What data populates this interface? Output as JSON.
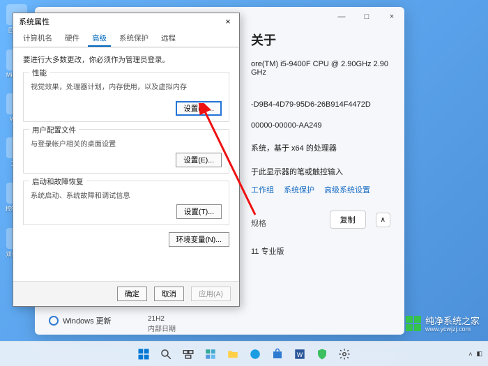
{
  "desktop": {
    "icons": [
      "回收站",
      "Micros...",
      "VLAN",
      "文档",
      "控制面板",
      "双击加..."
    ]
  },
  "about": {
    "header": "关于",
    "cpu": "ore(TM) i5-9400F CPU @ 2.90GHz   2.90 GHz",
    "device_id_suffix": "-D9B4-4D79-95D6-26B914F4472D",
    "product_id_suffix": "00000-00000-AA249",
    "system_type": "系统，基于 x64 的处理器",
    "pen_touch": "于此显示器的笔或触控输入",
    "links": {
      "domain": "工作组",
      "protect": "系统保护",
      "advanced": "高级系统设置"
    },
    "spec_heading": "规格",
    "copy": "复制",
    "chev": "∧",
    "edition": "11 专业版",
    "winupdate": "Windows 更新",
    "version_label": "21H2",
    "date_label": "内部日期",
    "win_min": "—",
    "win_max": "□",
    "win_close": "×"
  },
  "dialog": {
    "title": "系统属性",
    "close": "×",
    "tabs": [
      "计算机名",
      "硬件",
      "高级",
      "系统保护",
      "远程"
    ],
    "active_tab": 2,
    "admin_hint": "要进行大多数更改，你必须作为管理员登录。",
    "perf": {
      "title": "性能",
      "desc": "视觉效果，处理器计划，内存使用，以及虚拟内存",
      "btn": "设置(S)..."
    },
    "profile": {
      "title": "用户配置文件",
      "desc": "与登录帐户相关的桌面设置",
      "btn": "设置(E)..."
    },
    "startup": {
      "title": "启动和故障恢复",
      "desc": "系统启动、系统故障和调试信息",
      "btn": "设置(T)..."
    },
    "env_btn": "环境变量(N)...",
    "ok": "确定",
    "cancel": "取消",
    "apply": "应用(A)"
  },
  "watermark": {
    "brand": "纯净系统之家",
    "url": "www.ycwjzj.com"
  },
  "taskbar": {
    "icons": [
      "start-icon",
      "search-icon",
      "taskview-icon",
      "widgets-icon",
      "explorer-icon",
      "edge-icon",
      "store-icon",
      "word-icon",
      "security-icon",
      "settings-icon"
    ]
  }
}
